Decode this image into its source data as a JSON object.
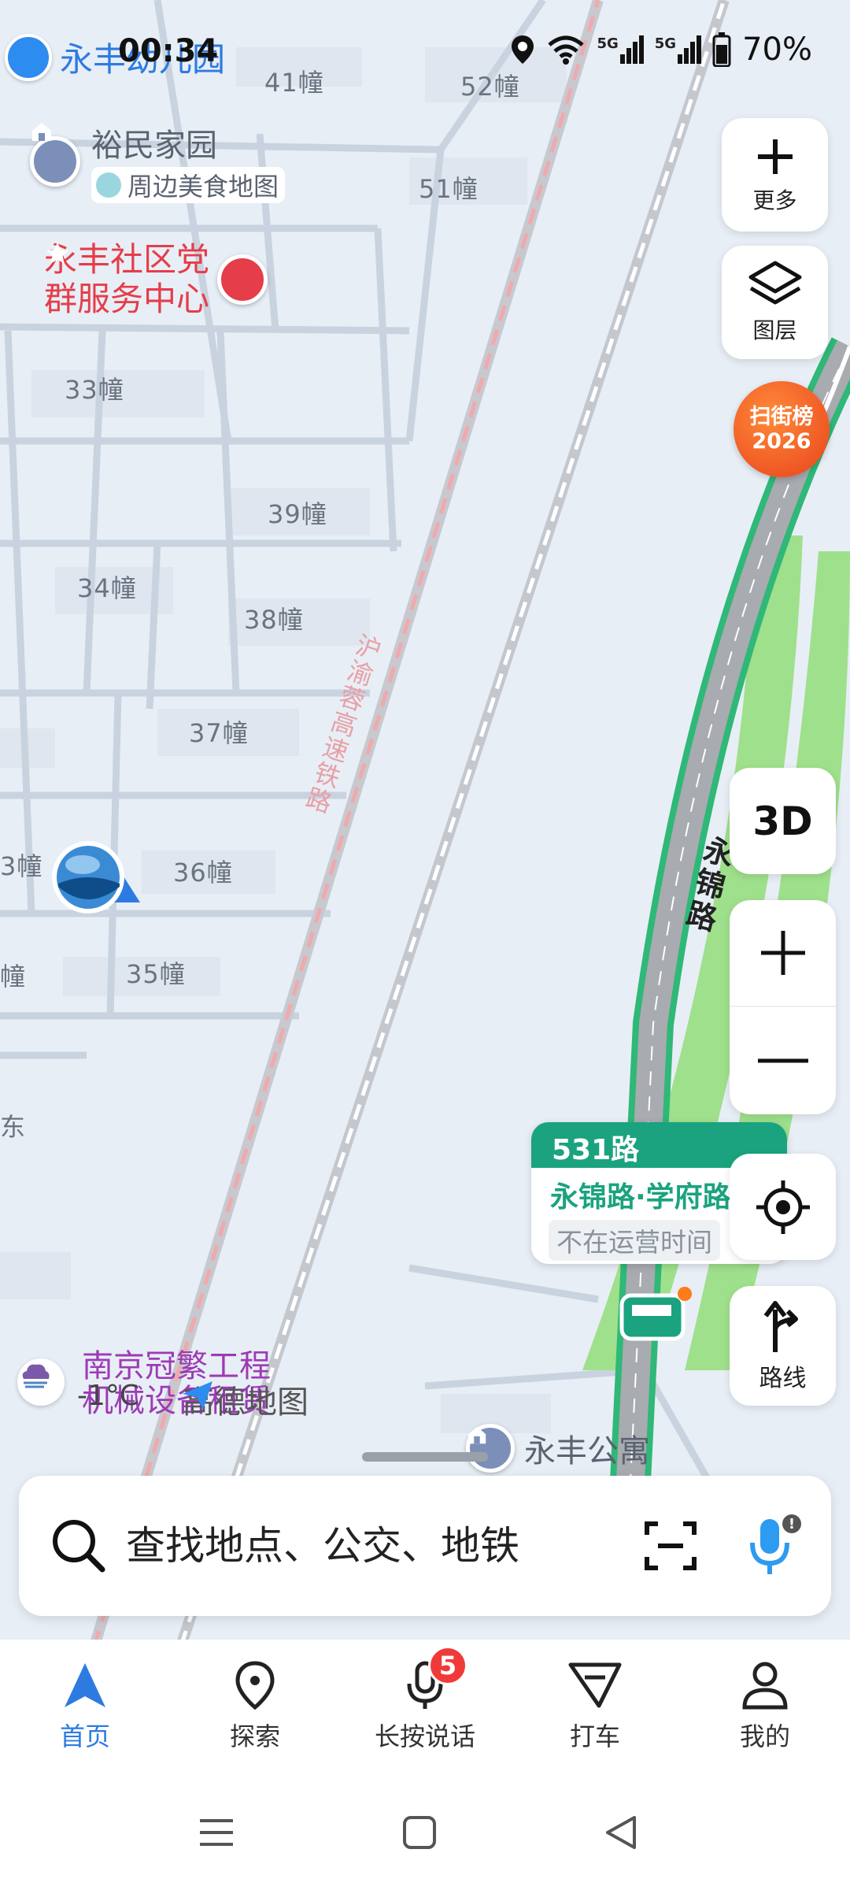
{
  "status_bar": {
    "time": "00:34",
    "battery_pct": "70%",
    "network_1": "5G",
    "network_2": "5G"
  },
  "map": {
    "top_poi_label": "永丰幼儿园",
    "blocks": [
      "41幢",
      "52幢",
      "51幢",
      "33幢",
      "39幢",
      "34幢",
      "38幢",
      "37幢",
      "36幢",
      "35幢"
    ],
    "block_partial_left_1": "3幢",
    "block_partial_left_2": "幢",
    "partial_char": "东",
    "poi_yumin": "裕民家园",
    "poi_food_map": "周边美食地图",
    "poi_yongfeng_center_1": "永丰社区党",
    "poi_yongfeng_center_2": "群服务中心",
    "railway_label": "沪渝蓉高速铁路",
    "road_label": "永锦路",
    "poi_nanjing_1": "南京冠繁工程",
    "poi_nanjing_2": "机械设备租赁",
    "weather_temp": "-1°C",
    "logo_text": "高德地图",
    "poi_apartment": "永丰公寓"
  },
  "controls": {
    "more_label": "更多",
    "layers_label": "图层",
    "rank_line1": "扫街榜",
    "rank_line2": "2026",
    "view_3d_label": "3D",
    "route_label": "路线"
  },
  "bus_card": {
    "route": "531路",
    "stop": "永锦路·学府路",
    "status": "不在运营时间"
  },
  "search": {
    "placeholder": "查找地点、公交、地铁"
  },
  "bottom_nav": {
    "items": [
      {
        "label": "首页",
        "active": true
      },
      {
        "label": "探索"
      },
      {
        "label": "长按说话",
        "badge": "5"
      },
      {
        "label": "打车"
      },
      {
        "label": "我的"
      }
    ]
  },
  "colors": {
    "accent": "#2d7be0",
    "bus_green": "#1aa37e",
    "road_green": "#9fe08c",
    "badge_red": "#f03a3a"
  }
}
